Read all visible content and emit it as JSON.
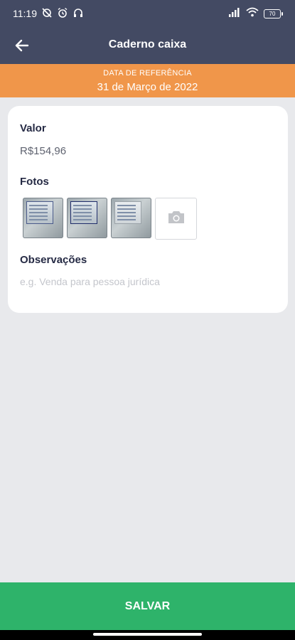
{
  "status_bar": {
    "time": "11:19",
    "battery": "70",
    "icons_left": [
      "no-sync-icon",
      "alarm-icon",
      "headphones-icon"
    ],
    "icons_right": [
      "signal-icon",
      "wifi-icon",
      "battery-icon"
    ]
  },
  "app_bar": {
    "title": "Caderno caixa",
    "back_icon": "back-arrow-icon"
  },
  "reference": {
    "label": "DATA DE REFERÊNCIA",
    "date": "31 de Março de 2022"
  },
  "form": {
    "valor_label": "Valor",
    "valor_value": "R$154,96",
    "fotos_label": "Fotos",
    "photos_count": 3,
    "add_photo_icon": "camera-icon",
    "observacoes_label": "Observações",
    "observacoes_placeholder": "e.g. Venda para pessoa jurídica",
    "observacoes_value": ""
  },
  "actions": {
    "save_label": "SALVAR"
  },
  "colors": {
    "header": "#434a63",
    "banner": "#f0964a",
    "save": "#2eb36a",
    "background": "#e8e9ec"
  }
}
